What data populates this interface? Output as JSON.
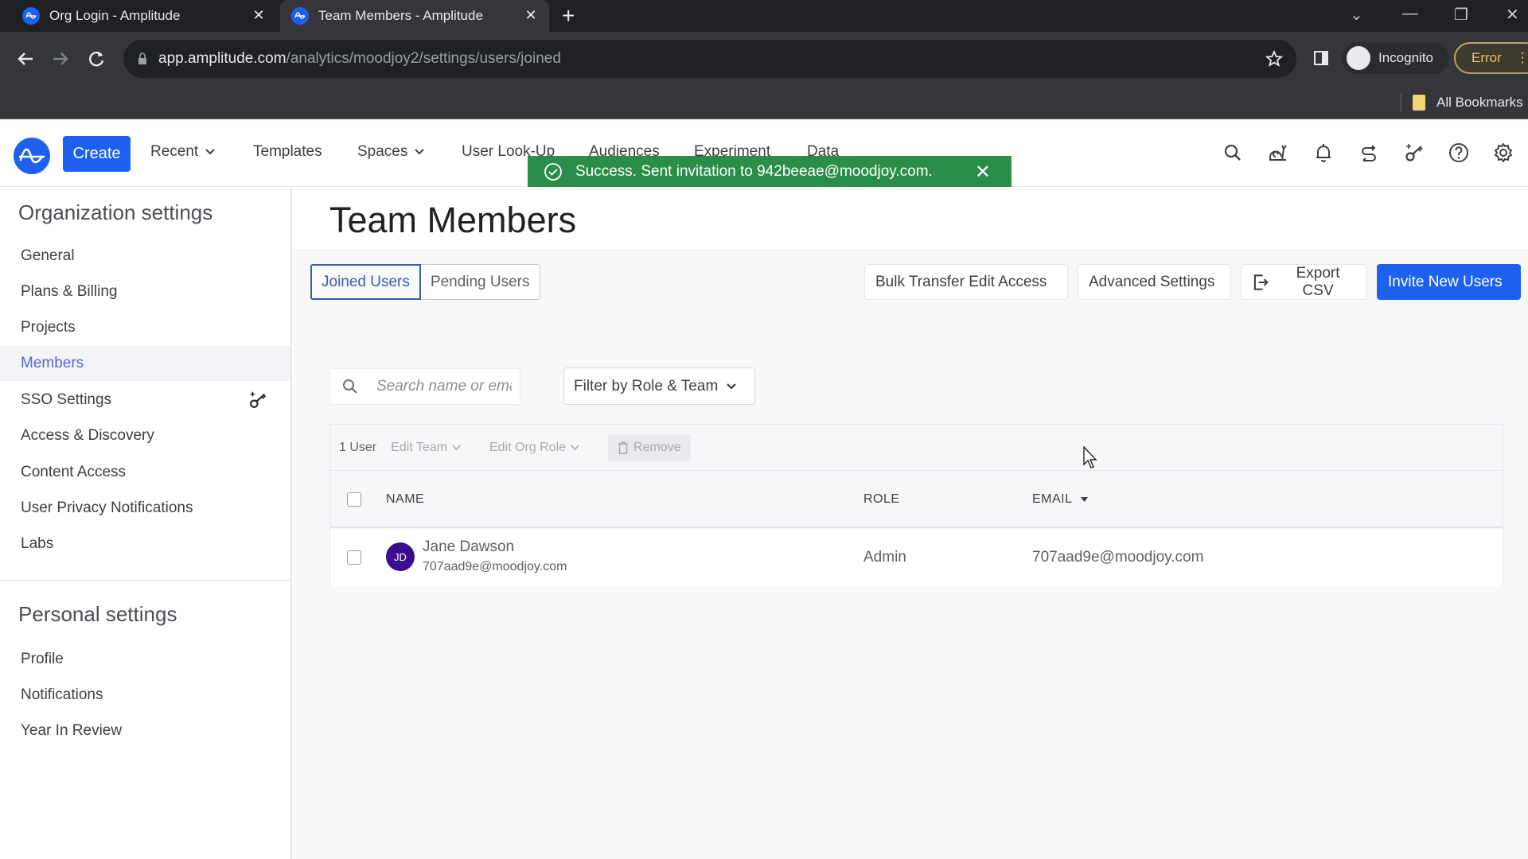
{
  "browser": {
    "tabs": [
      {
        "title": "Org Login - Amplitude",
        "active": false
      },
      {
        "title": "Team Members - Amplitude",
        "active": true
      }
    ],
    "url_host": "app.amplitude.com",
    "url_path": "/analytics/moodjoy2/settings/users/joined",
    "profile_label": "Incognito",
    "error_label": "Error",
    "bookmarks_label": "All Bookmarks"
  },
  "appnav": {
    "create_label": "Create",
    "items": [
      {
        "label": "Recent",
        "dropdown": true
      },
      {
        "label": "Templates",
        "dropdown": false
      },
      {
        "label": "Spaces",
        "dropdown": true
      },
      {
        "label": "User Look-Up",
        "dropdown": false
      },
      {
        "label": "Audiences",
        "dropdown": false
      },
      {
        "label": "Experiment",
        "dropdown": false
      },
      {
        "label": "Data",
        "dropdown": false
      }
    ],
    "icons": [
      "search-icon",
      "snail-icon",
      "bell-icon",
      "switch-icon",
      "key-icon",
      "help-icon",
      "gear-icon"
    ]
  },
  "toast": {
    "message": "Success. Sent invitation to 942beeae@moodjoy.com.",
    "color": "#2a8d49"
  },
  "sidebar": {
    "org_heading": "Organization settings",
    "org_items": [
      {
        "label": "General"
      },
      {
        "label": "Plans & Billing"
      },
      {
        "label": "Projects"
      },
      {
        "label": "Members",
        "active": true
      },
      {
        "label": "SSO Settings",
        "icon": "key-icon"
      },
      {
        "label": "Access & Discovery"
      },
      {
        "label": "Content Access"
      },
      {
        "label": "User Privacy Notifications"
      },
      {
        "label": "Labs"
      }
    ],
    "personal_heading": "Personal settings",
    "personal_items": [
      {
        "label": "Profile"
      },
      {
        "label": "Notifications"
      },
      {
        "label": "Year In Review"
      }
    ]
  },
  "main": {
    "title": "Team Members",
    "tabs": [
      {
        "label": "Joined Users",
        "selected": true
      },
      {
        "label": "Pending Users",
        "selected": false
      }
    ],
    "actions": {
      "bulk_transfer": "Bulk Transfer Edit Access",
      "advanced_settings": "Advanced Settings",
      "export_csv": "Export CSV",
      "invite": "Invite New Users"
    },
    "search": {
      "placeholder": "Search name or email",
      "value": ""
    },
    "filter_label": "Filter by Role & Team",
    "toolbar": {
      "count": "1 User",
      "edit_team": "Edit Team",
      "edit_org_role": "Edit Org Role",
      "remove": "Remove"
    },
    "table": {
      "columns": [
        "NAME",
        "ROLE",
        "EMAIL"
      ],
      "sort_column": "EMAIL",
      "rows": [
        {
          "initials": "JD",
          "name": "Jane Dawson",
          "sub_email": "707aad9e@moodjoy.com",
          "role": "Admin",
          "email": "707aad9e@moodjoy.com"
        }
      ]
    }
  },
  "colors": {
    "brand": "#1e61f0",
    "active_link": "#5960d9",
    "avatar": "#3a0f8f"
  }
}
